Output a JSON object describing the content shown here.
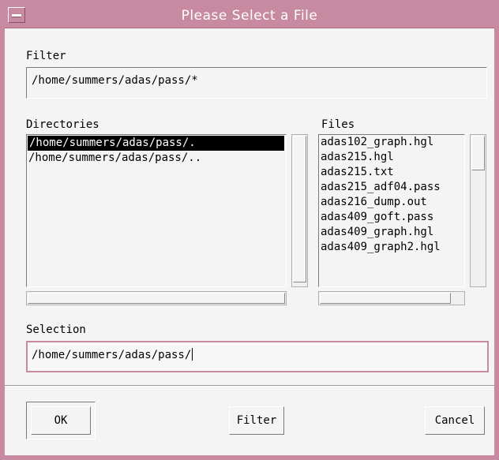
{
  "window": {
    "title": "Please Select a File"
  },
  "filter": {
    "label": "Filter",
    "value": "/home/summers/adas/pass/*"
  },
  "directories": {
    "label": "Directories",
    "items": [
      "/home/summers/adas/pass/.",
      "/home/summers/adas/pass/.."
    ],
    "selected_index": 0
  },
  "files": {
    "label": "Files",
    "items": [
      "adas102_graph.hgl",
      "adas215.hgl",
      "adas215.txt",
      "adas215_adf04.pass",
      "adas216_dump.out",
      "adas409_goft.pass",
      "adas409_graph.hgl",
      "adas409_graph2.hgl"
    ]
  },
  "selection": {
    "label": "Selection",
    "value": "/home/summers/adas/pass/"
  },
  "buttons": {
    "ok": "OK",
    "filter": "Filter",
    "cancel": "Cancel"
  },
  "colors": {
    "frame": "#c78aa0",
    "background": "#f4f4f4",
    "selected_bg": "#000000"
  }
}
